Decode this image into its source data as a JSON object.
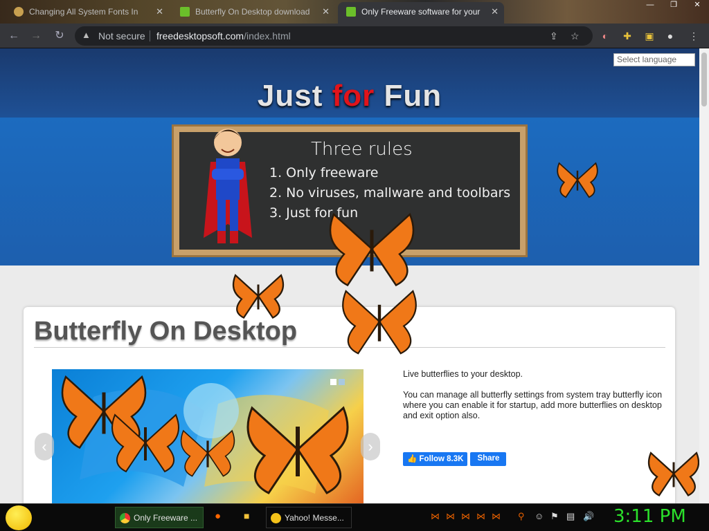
{
  "browser": {
    "tabs": [
      {
        "title": "Changing All System Fonts In",
        "active": false
      },
      {
        "title": "Butterfly On Desktop download",
        "active": false
      },
      {
        "title": "Only Freeware software for your",
        "active": true
      }
    ],
    "address": {
      "security_label": "Not secure",
      "domain": "freedesktopsoft.com",
      "path": "/index.html"
    }
  },
  "page": {
    "language_select": "Select language",
    "banner": {
      "title_part1": "Just ",
      "title_part2": "for",
      "title_part3": " Fun",
      "board_heading": "Three rules",
      "rules": [
        "1. Only freeware",
        "2. No viruses, mallware and toolbars",
        "3. Just for fun"
      ]
    },
    "product": {
      "title": "Butterfly On Desktop",
      "desc1": "Live butterflies to your desktop.",
      "desc2": "You can manage all butterfly settings from system tray butterfly icon where you can enable it for startup, add more butterflies on desktop and exit option also.",
      "follow_label": "Follow",
      "follow_count": "8.3K",
      "share_label": "Share"
    }
  },
  "taskbar": {
    "items": [
      {
        "label": "Only Freeware ..."
      },
      {
        "label": "Yahoo! Messe..."
      }
    ],
    "clock": "3:11 PM"
  },
  "colors": {
    "accent_red": "#e0141b",
    "facebook": "#1877f2",
    "clock": "#2be12b"
  }
}
